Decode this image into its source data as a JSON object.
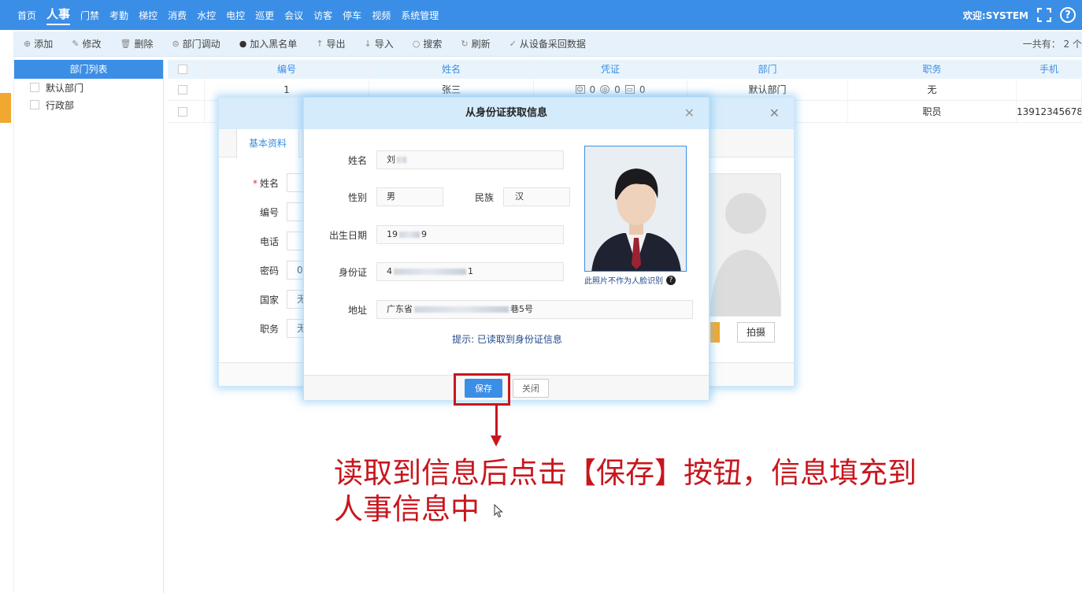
{
  "nav": {
    "items": [
      "首页",
      "人事",
      "门禁",
      "考勤",
      "梯控",
      "消费",
      "水控",
      "电控",
      "巡更",
      "会议",
      "访客",
      "停车",
      "视频",
      "系统管理"
    ],
    "active_index": 1,
    "welcome": "欢迎:SYSTEM",
    "help": "?"
  },
  "toolbar": {
    "add": "添加",
    "edit": "修改",
    "delete": "删除",
    "dept_move": "部门调动",
    "blacklist": "加入黑名单",
    "export": "导出",
    "import": "导入",
    "search": "搜索",
    "refresh": "刷新",
    "collect": "从设备采回数据",
    "total": "一共有： 2 个"
  },
  "dept_panel": {
    "title": "部门列表",
    "items": [
      "默认部门",
      "行政部"
    ]
  },
  "table": {
    "headers": [
      "编号",
      "姓名",
      "凭证",
      "部门",
      "职务",
      "手机"
    ],
    "rows": [
      {
        "id": "1",
        "name": "张三",
        "cred_face": "0",
        "cred_fp": "0",
        "cred_card": "0",
        "dept": "默认部门",
        "job": "无",
        "phone": ""
      },
      {
        "id": "",
        "name": "",
        "dept": "",
        "job": "职员",
        "phone": "13912345678"
      }
    ]
  },
  "back_modal": {
    "tab": "基本资料",
    "fields": [
      {
        "label": "姓名",
        "required": true,
        "value": ""
      },
      {
        "label": "编号",
        "required": false,
        "value": ""
      },
      {
        "label": "电话",
        "required": false,
        "value": ""
      },
      {
        "label": "密码",
        "required": false,
        "value": "00"
      },
      {
        "label": "国家",
        "required": false,
        "value": "无"
      },
      {
        "label": "职务",
        "required": false,
        "value": "无"
      }
    ],
    "snap_button": "拍摄"
  },
  "id_modal": {
    "title": "从身份证获取信息",
    "name_label": "姓名",
    "name_value": "刘",
    "gender_label": "性别",
    "gender_value": "男",
    "ethnic_label": "民族",
    "ethnic_value": "汉",
    "birth_label": "出生日期",
    "birth_prefix": "19",
    "birth_suffix": "9",
    "id_label": "身份证",
    "id_prefix": "4",
    "id_suffix": "1",
    "addr_label": "地址",
    "addr_prefix": "广东省",
    "addr_suffix": "巷5号",
    "photo_note": "此照片不作为人脸识别",
    "hint": "提示: 已读取到身份证信息",
    "save": "保存",
    "close": "关闭"
  },
  "annotation": "读取到信息后点击【保存】按钮，信息填充到人事信息中",
  "colors": {
    "primary": "#3a8ee6",
    "annotation": "#c8161d",
    "accent": "#f0a830"
  }
}
